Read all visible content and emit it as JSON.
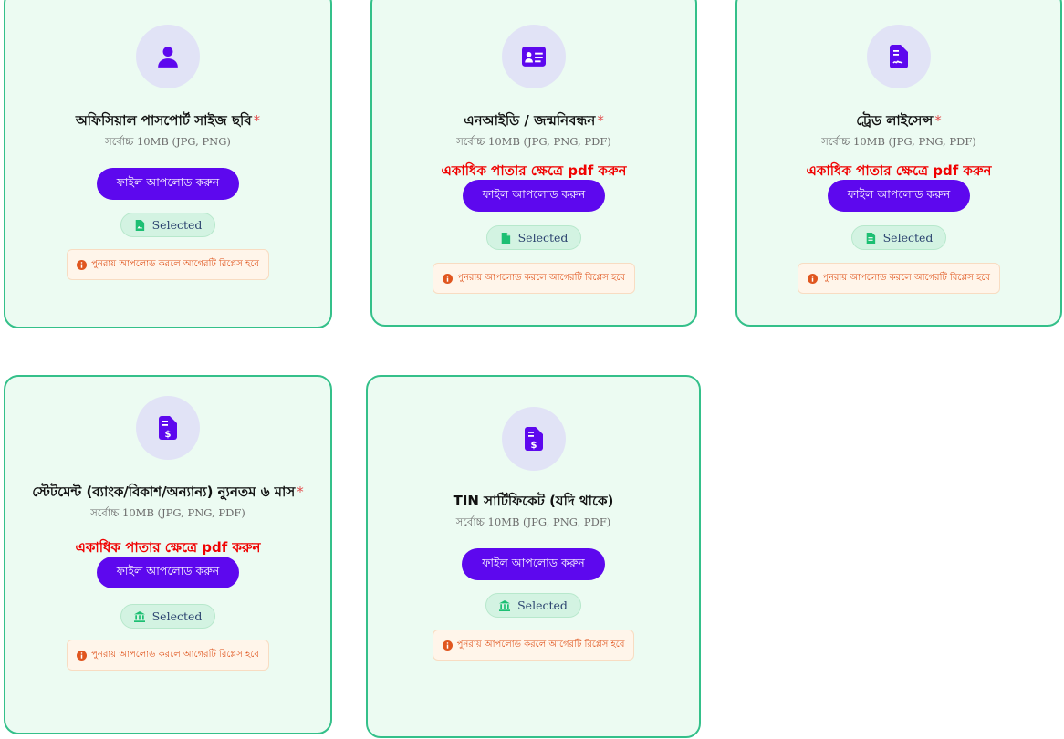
{
  "common": {
    "upload_label": "ফাইল আপলোড করুন",
    "selected_label": "Selected",
    "replace_warning": "পুনরায় আপলোড করলে আগেরটি রিপ্লেস হবে",
    "multi_page_note": "একাধিক পাতার ক্ষেত্রে pdf করুন",
    "required_mark": "*"
  },
  "colors": {
    "accent": "#5d08ee",
    "card_border": "#34c08a",
    "card_bg": "#ecfbf2",
    "required": "#e34d4d",
    "note": "#f00000",
    "warning": "#e0561f"
  },
  "cards": [
    {
      "title": "অফিসিয়াল পাসপোর্ট সাইজ ছবি",
      "required": true,
      "hint": "সর্বোচ্চ 10MB (JPG, PNG)",
      "icon": "user-icon",
      "status_icon": "file-image-icon"
    },
    {
      "title": "এনআইডি / জন্মনিবন্ধন",
      "required": true,
      "hint": "সর্বোচ্চ 10MB (JPG, PNG, PDF)",
      "icon": "id-card-icon",
      "status_icon": "file-icon"
    },
    {
      "title": "ট্রেড লাইসেন্স",
      "required": true,
      "hint": "সর্বোচ্চ 10MB (JPG, PNG, PDF)",
      "icon": "file-contract-icon",
      "status_icon": "file-alt-icon"
    },
    {
      "title": "স্টেটমেন্ট (ব্যাংক/বিকাশ/অন্যান্য) ন্যুনতম ৬ মাস",
      "required": true,
      "hint": "সর্বোচ্চ 10MB (JPG, PNG, PDF)",
      "icon": "file-invoice-dollar-icon",
      "status_icon": "bank-icon"
    },
    {
      "title": "TIN সার্টিফিকেট (যদি থাকে)",
      "required": false,
      "hint": "সর্বোচ্চ 10MB (JPG, PNG, PDF)",
      "icon": "file-invoice-dollar-icon",
      "status_icon": "bank-icon"
    }
  ]
}
